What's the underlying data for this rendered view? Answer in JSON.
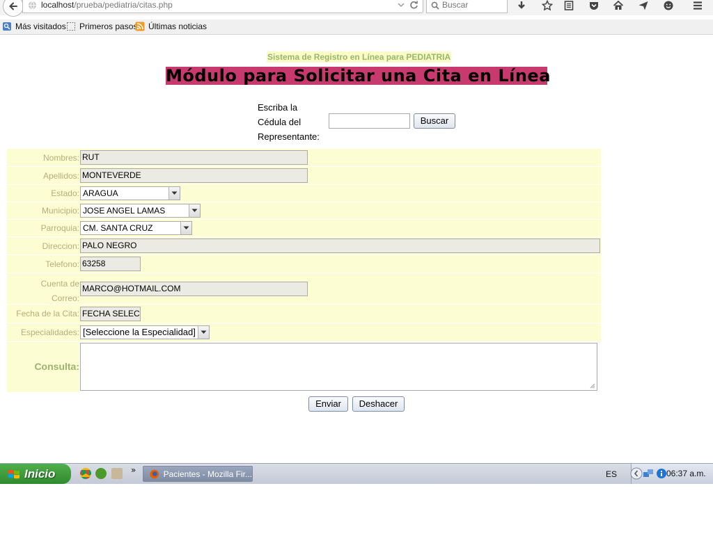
{
  "browser": {
    "url_host": "localhost",
    "url_path": "/prueba/pediatria/citas.php",
    "search_placeholder": "Buscar"
  },
  "bookmarks": [
    {
      "label": "Más visitados"
    },
    {
      "label": "Primeros pasos"
    },
    {
      "label": "Últimas noticias"
    }
  ],
  "page": {
    "subtitle": "Sistema de Registro en Línea para PEDIATRIA",
    "title": "Módulo para Solicitar una Cita en Línea",
    "cedula_label_1": "Escriba la",
    "cedula_label_2": "Cédula del",
    "cedula_label_3": "Representante:",
    "search_button": "Buscar"
  },
  "form": {
    "nombres_label": "Nombres:",
    "nombres_value": "RUT",
    "apellidos_label": "Apellidos:",
    "apellidos_value": "MONTEVERDE",
    "estado_label": "Estado:",
    "estado_value": "ARAGUA",
    "municipio_label": "Municipio:",
    "municipio_value": "JOSE ANGEL LAMAS",
    "parroquia_label": "Parroquia:",
    "parroquia_value": "CM. SANTA CRUZ",
    "direccion_label": "Direccion:",
    "direccion_value": "PALO NEGRO",
    "telefono_label": "Telefono:",
    "telefono_value": "63258",
    "correo_label_1": "Cuenta de",
    "correo_label_2": "Correo:",
    "correo_value": "MARCO@HOTMAIL.COM",
    "fecha_label": "Fecha de la Cita:",
    "fecha_value": "FECHA SELECC",
    "especialidades_label": "Especialidades:",
    "especialidades_value": "[Seleccione la Especialidad]",
    "consulta_label": "Consulta:",
    "enviar_button": "Enviar",
    "deshacer_button": "Deshacer"
  },
  "taskbar": {
    "start_label": "Inicio",
    "task_label": "Pacientes - Mozilla Fir...",
    "language": "ES",
    "clock": "06:37 a.m.",
    "more_glyph": "»"
  },
  "colors": {
    "title_bg": "#c83a6e",
    "subtitle_bg": "#fbfbc8",
    "row_bg": "#fdfdd4",
    "label_text": "#b0b07a"
  }
}
